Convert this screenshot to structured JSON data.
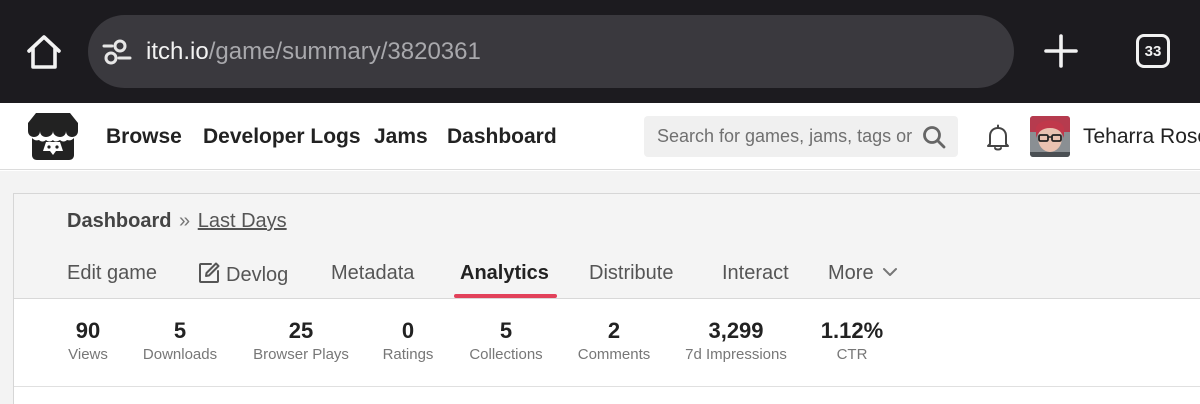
{
  "browser": {
    "url_domain": "itch.io",
    "url_path": "/game/summary/3820361",
    "tab_count": "33"
  },
  "nav": {
    "links": [
      "Browse",
      "Developer Logs",
      "Jams",
      "Dashboard"
    ],
    "search_placeholder": "Search for games, jams, tags or c",
    "user_name": "Teharra Rose"
  },
  "breadcrumb": {
    "root": "Dashboard",
    "separator": "»",
    "current": "Last Days"
  },
  "tabs": [
    "Edit game",
    "Devlog",
    "Metadata",
    "Analytics",
    "Distribute",
    "Interact",
    "More"
  ],
  "active_tab": "Analytics",
  "stats": [
    {
      "value": "90",
      "label": "Views"
    },
    {
      "value": "5",
      "label": "Downloads"
    },
    {
      "value": "25",
      "label": "Browser Plays"
    },
    {
      "value": "0",
      "label": "Ratings"
    },
    {
      "value": "5",
      "label": "Collections"
    },
    {
      "value": "2",
      "label": "Comments"
    },
    {
      "value": "3,299",
      "label": "7d Impressions"
    },
    {
      "value": "1.12%",
      "label": "CTR"
    }
  ],
  "colors": {
    "browser_bar": "#1c1b1f",
    "url_box": "#3a393e",
    "active_tab_underline": "#e2415a"
  }
}
